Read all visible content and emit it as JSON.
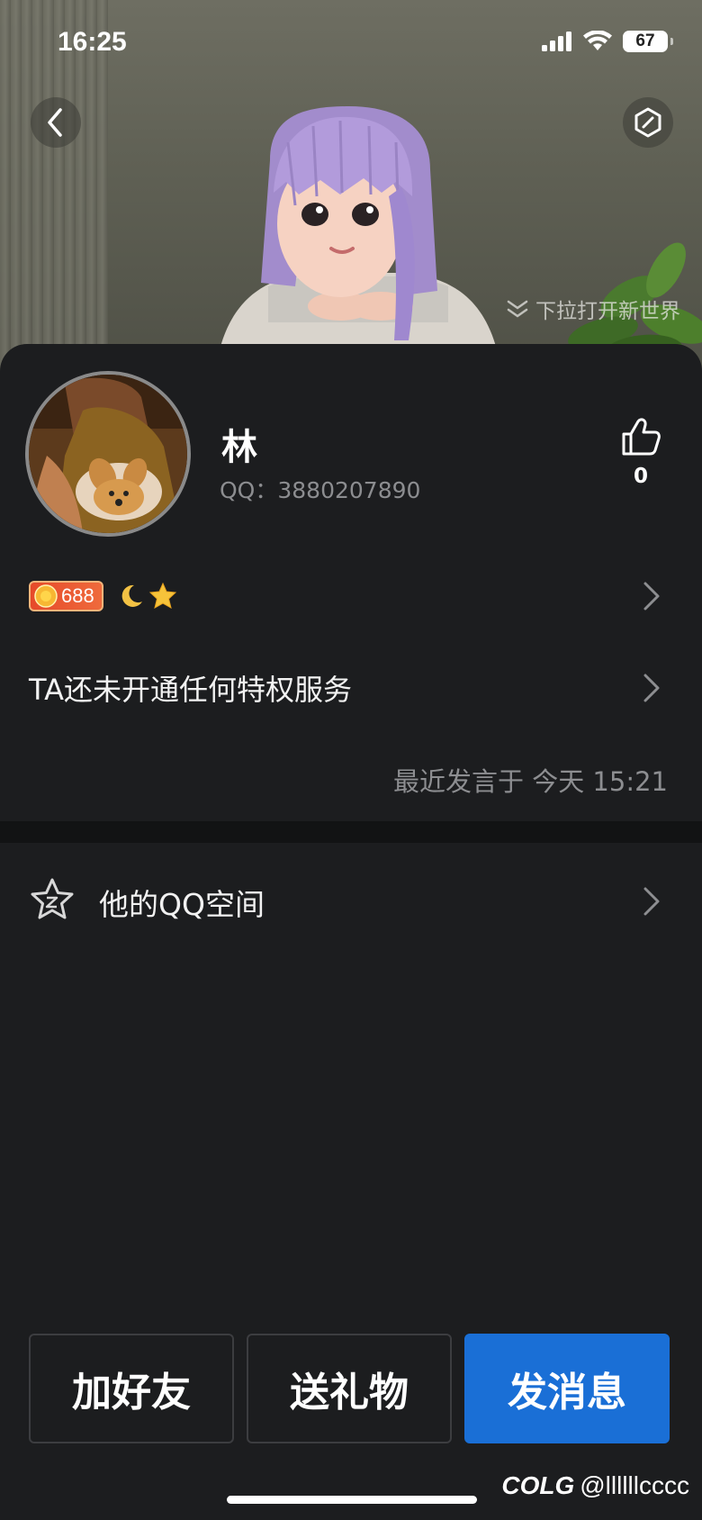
{
  "status_bar": {
    "time": "16:25",
    "battery": "67"
  },
  "hero": {
    "pull_hint": "下拉打开新世界"
  },
  "profile": {
    "nickname": "林",
    "qq_line": "QQ：3880207890",
    "like_count": "0"
  },
  "level": {
    "value": "688"
  },
  "privilege": {
    "text": "TA还未开通任何特权服务"
  },
  "recent": {
    "text": "最近发言于 今天 15:21"
  },
  "qzone": {
    "label": "他的QQ空间"
  },
  "actions": {
    "add_friend": "加好友",
    "send_gift": "送礼物",
    "send_message": "发消息"
  },
  "watermark": {
    "text": "@llllllcccc",
    "brand": "COLG"
  },
  "colors": {
    "primary_button": "#1a6fd6",
    "background": "#1c1d1f"
  }
}
